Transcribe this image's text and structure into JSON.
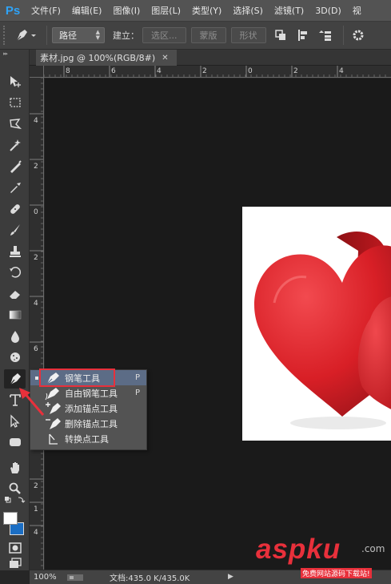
{
  "app": {
    "logo_text": "Ps"
  },
  "menubar": {
    "items": [
      "文件(F)",
      "编辑(E)",
      "图像(I)",
      "图层(L)",
      "类型(Y)",
      "选择(S)",
      "滤镜(T)",
      "3D(D)",
      "视"
    ]
  },
  "options": {
    "mode_value": "路径",
    "build_label": "建立：",
    "selection_button": "选区...",
    "mask_button": "蒙版",
    "shape_button": "形状"
  },
  "document": {
    "tab_title": "素材.jpg @ 100%(RGB/8#)",
    "close_glyph": "✕"
  },
  "rulers": {
    "top_labels": [
      "8",
      "6",
      "4",
      "2",
      "0",
      "2",
      "4"
    ],
    "left_labels": [
      "4",
      "2",
      "0",
      "2",
      "4",
      "6",
      "8",
      "1",
      "2",
      "1",
      "4"
    ]
  },
  "flyout": {
    "items": [
      {
        "label": "钢笔工具",
        "shortcut": "P",
        "selected": true,
        "icon": "pen-icon"
      },
      {
        "label": "自由钢笔工具",
        "shortcut": "P",
        "selected": false,
        "icon": "freeform-pen-icon"
      },
      {
        "label": "添加锚点工具",
        "shortcut": "",
        "selected": false,
        "icon": "add-anchor-icon"
      },
      {
        "label": "删除锚点工具",
        "shortcut": "",
        "selected": false,
        "icon": "delete-anchor-icon"
      },
      {
        "label": "转换点工具",
        "shortcut": "",
        "selected": false,
        "icon": "convert-point-icon"
      }
    ]
  },
  "status": {
    "zoom": "100%",
    "doc_info": "文档:435.0 K/435.0K",
    "arrow": "▶"
  },
  "watermark": {
    "main": "aspku",
    "suffix": ".com",
    "sub": "免费网站源码下载站!"
  },
  "colors": {
    "accent_red": "#e8303b",
    "ps_blue": "#2fa3f7",
    "heart_red": "#d81f26"
  }
}
